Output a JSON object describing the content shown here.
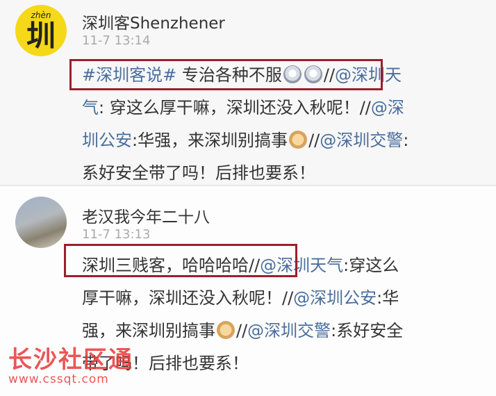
{
  "posts": [
    {
      "author": "深圳客Shenzhener",
      "time": "11-7 13:14",
      "avatar_pinyin": "zhèn",
      "avatar_char": "圳",
      "lines": {
        "l1_tag": "#深圳客说#",
        "l1_text": " 专治各种不服",
        "l1_sep": "//",
        "l1_mention": "@深圳天",
        "l2_mention": "气",
        "l2_text": ": 穿这么厚干嘛，深圳还没入秋呢！//",
        "l2_mention2": "@深",
        "l3_mention": "圳公安",
        "l3_text": ":华强，来深圳别搞事",
        "l3_sep": "//",
        "l3_mention2": "@深圳交警",
        "l3_colon": ":",
        "l4_text": "系好安全带了吗！后排也要系！"
      }
    },
    {
      "author": "老汉我今年二十八",
      "time": "11-7 13:13",
      "lines": {
        "l1_text": "深圳三贱客，哈哈哈哈//",
        "l1_mention": "@深圳天气",
        "l1_text2": ":穿这么",
        "l2_text": "厚干嘛，深圳还没入秋呢！//",
        "l2_mention": "@深圳公安",
        "l2_text2": ":华",
        "l3_text": "强，来深圳别搞事",
        "l3_sep": "//",
        "l3_mention": "@深圳交警",
        "l3_text2": ":系好安全",
        "l4_text": "带了吗！后排也要系！"
      }
    }
  ],
  "emoji_icons": [
    "shocked-face-icon",
    "doge-icon"
  ],
  "watermark": {
    "name": "长沙社区通",
    "url": "www.cssqt.com"
  },
  "colors": {
    "link": "#4a6e9c",
    "highlight_box": "#9b1f2c",
    "watermark": "#e93a3a"
  }
}
